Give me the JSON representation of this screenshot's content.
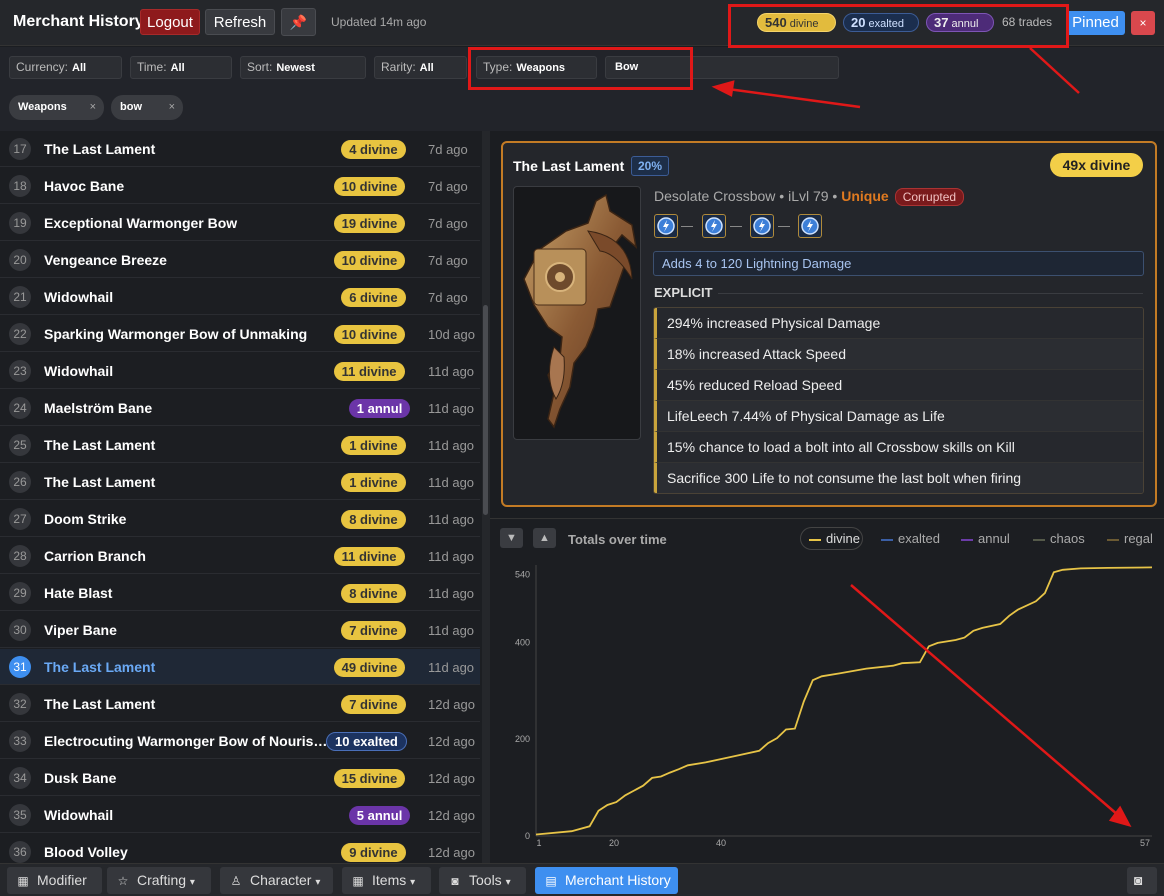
{
  "header": {
    "title": "Merchant History",
    "logout_label": "Logout",
    "refresh_label": "Refresh",
    "pin_icon": "pin-icon",
    "updated": "Updated 14m ago",
    "totals": {
      "divine_amount": "540",
      "divine_label": "divine",
      "exalted_amount": "20",
      "exalted_label": "exalted",
      "annul_amount": "37",
      "annul_label": "annul"
    },
    "trades": "68 trades",
    "pinned_label": "Pinned",
    "close_label": "×"
  },
  "filters": {
    "currency": {
      "label": "Currency:",
      "value": "All"
    },
    "time": {
      "label": "Time:",
      "value": "All"
    },
    "sort": {
      "label": "Sort:",
      "value": "Newest"
    },
    "rarity": {
      "label": "Rarity:",
      "value": "All"
    },
    "type": {
      "label": "Type:",
      "value": "Weapons"
    },
    "search_value": "Bow",
    "chips": [
      {
        "label": "Weapons",
        "remove": "×"
      },
      {
        "label": "bow",
        "remove": "×"
      }
    ]
  },
  "trades": [
    {
      "n": "17",
      "name": "The Last Lament",
      "price": "4 divine",
      "cur": "divine",
      "age": "7d ago"
    },
    {
      "n": "18",
      "name": "Havoc Bane",
      "price": "10 divine",
      "cur": "divine",
      "age": "7d ago"
    },
    {
      "n": "19",
      "name": "Exceptional Warmonger Bow",
      "price": "19 divine",
      "cur": "divine",
      "age": "7d ago"
    },
    {
      "n": "20",
      "name": "Vengeance Breeze",
      "price": "10 divine",
      "cur": "divine",
      "age": "7d ago"
    },
    {
      "n": "21",
      "name": "Widowhail",
      "price": "6 divine",
      "cur": "divine",
      "age": "7d ago"
    },
    {
      "n": "22",
      "name": "Sparking Warmonger Bow of Unmaking",
      "price": "10 divine",
      "cur": "divine",
      "age": "10d ago"
    },
    {
      "n": "23",
      "name": "Widowhail",
      "price": "11 divine",
      "cur": "divine",
      "age": "11d ago"
    },
    {
      "n": "24",
      "name": "Maelström Bane",
      "price": "1 annul",
      "cur": "annul",
      "age": "11d ago"
    },
    {
      "n": "25",
      "name": "The Last Lament",
      "price": "1 divine",
      "cur": "divine",
      "age": "11d ago"
    },
    {
      "n": "26",
      "name": "The Last Lament",
      "price": "1 divine",
      "cur": "divine",
      "age": "11d ago"
    },
    {
      "n": "27",
      "name": "Doom Strike",
      "price": "8 divine",
      "cur": "divine",
      "age": "11d ago"
    },
    {
      "n": "28",
      "name": "Carrion Branch",
      "price": "11 divine",
      "cur": "divine",
      "age": "11d ago"
    },
    {
      "n": "29",
      "name": "Hate Blast",
      "price": "8 divine",
      "cur": "divine",
      "age": "11d ago"
    },
    {
      "n": "30",
      "name": "Viper Bane",
      "price": "7 divine",
      "cur": "divine",
      "age": "11d ago"
    },
    {
      "n": "31",
      "name": "The Last Lament",
      "price": "49 divine",
      "cur": "divine",
      "age": "11d ago",
      "selected": true
    },
    {
      "n": "32",
      "name": "The Last Lament",
      "price": "7 divine",
      "cur": "divine",
      "age": "12d ago"
    },
    {
      "n": "33",
      "name": "Electrocuting Warmonger Bow of Nourish...",
      "price": "10 exalted",
      "cur": "exalted",
      "age": "12d ago"
    },
    {
      "n": "34",
      "name": "Dusk Bane",
      "price": "15 divine",
      "cur": "divine",
      "age": "12d ago"
    },
    {
      "n": "35",
      "name": "Widowhail",
      "price": "5 annul",
      "cur": "annul",
      "age": "12d ago"
    },
    {
      "n": "36",
      "name": "Blood Volley",
      "price": "9 divine",
      "cur": "divine",
      "age": "12d ago"
    }
  ],
  "detail": {
    "name": "The Last Lament",
    "quality": "20%",
    "price": "49x divine",
    "base": "Desolate Crossbow",
    "ilvl": "iLvl 79",
    "rarity": "Unique",
    "corrupted": "Corrupted",
    "socket_icon": "lightning-rune-icon",
    "implicit": "Adds 4 to 120 Lightning Damage",
    "explicit_heading": "EXPLICIT",
    "mods": [
      "294% increased Physical Damage",
      "18% increased Attack Speed",
      "45% reduced Reload Speed",
      "LifeLeech 7.44% of Physical Damage as Life",
      "15% chance to load a bolt into all Crossbow skills on Kill",
      "Sacrifice 300 Life to not consume the last bolt when firing"
    ]
  },
  "chart_panel": {
    "down_label": "▼",
    "up_label": "▲",
    "title": "Totals over time",
    "legend": [
      {
        "name": "divine",
        "color": "#e7c447"
      },
      {
        "name": "exalted",
        "color": "#3b5fa5"
      },
      {
        "name": "annul",
        "color": "#6b3ca8"
      },
      {
        "name": "chaos",
        "color": "#555a4a"
      },
      {
        "name": "regal",
        "color": "#6b5a33"
      }
    ]
  },
  "chart_data": {
    "type": "line",
    "title": "Totals over time",
    "xlim": [
      1,
      57
    ],
    "ylim": [
      0,
      540
    ],
    "x_ticks": [
      "1",
      "20",
      "40",
      "57"
    ],
    "y_ticks": [
      "0",
      "200",
      "400",
      "540"
    ],
    "series": [
      {
        "name": "divine",
        "color": "#e7c447",
        "points": [
          [
            1,
            3
          ],
          [
            5,
            10
          ],
          [
            7,
            20
          ],
          [
            8,
            52
          ],
          [
            9,
            64
          ],
          [
            10,
            70
          ],
          [
            11,
            84
          ],
          [
            12,
            94
          ],
          [
            13,
            104
          ],
          [
            14,
            120
          ],
          [
            15,
            123
          ],
          [
            16,
            131
          ],
          [
            17,
            138
          ],
          [
            18,
            146
          ],
          [
            20,
            152
          ],
          [
            23,
            164
          ],
          [
            26,
            176
          ],
          [
            27,
            192
          ],
          [
            28,
            202
          ],
          [
            29,
            220
          ],
          [
            30,
            222
          ],
          [
            31,
            278
          ],
          [
            32,
            322
          ],
          [
            33,
            330
          ],
          [
            35,
            336
          ],
          [
            38,
            346
          ],
          [
            41,
            352
          ],
          [
            42,
            357
          ],
          [
            44,
            359
          ],
          [
            45,
            392
          ],
          [
            46,
            399
          ],
          [
            48,
            405
          ],
          [
            49,
            410
          ],
          [
            50,
            424
          ],
          [
            51,
            430
          ],
          [
            53,
            438
          ],
          [
            54,
            455
          ],
          [
            55,
            468
          ],
          [
            57,
            485
          ],
          [
            58,
            502
          ],
          [
            59,
            545
          ],
          [
            60,
            550
          ],
          [
            62,
            553
          ],
          [
            65,
            554
          ],
          [
            70,
            555
          ]
        ]
      },
      {
        "name": "exalted",
        "color": "#3b5fa5",
        "points": []
      },
      {
        "name": "annul",
        "color": "#6b3ca8",
        "points": []
      },
      {
        "name": "chaos",
        "color": "#555a4a",
        "points": []
      },
      {
        "name": "regal",
        "color": "#6b5a33",
        "points": []
      }
    ]
  },
  "bottom_tabs": [
    {
      "label": "Modifier",
      "icon": "grid-icon"
    },
    {
      "label": "Crafting",
      "icon": "star-icon",
      "caret": "▾"
    },
    {
      "label": "Character",
      "icon": "person-icon",
      "caret": "▾"
    },
    {
      "label": "Items",
      "icon": "grid-icon",
      "caret": "▾"
    },
    {
      "label": "Tools",
      "icon": "camera-icon",
      "caret": "▾"
    },
    {
      "label": "Merchant History",
      "icon": "table-icon",
      "active": true
    }
  ],
  "screenshot_icon": "camera-icon"
}
